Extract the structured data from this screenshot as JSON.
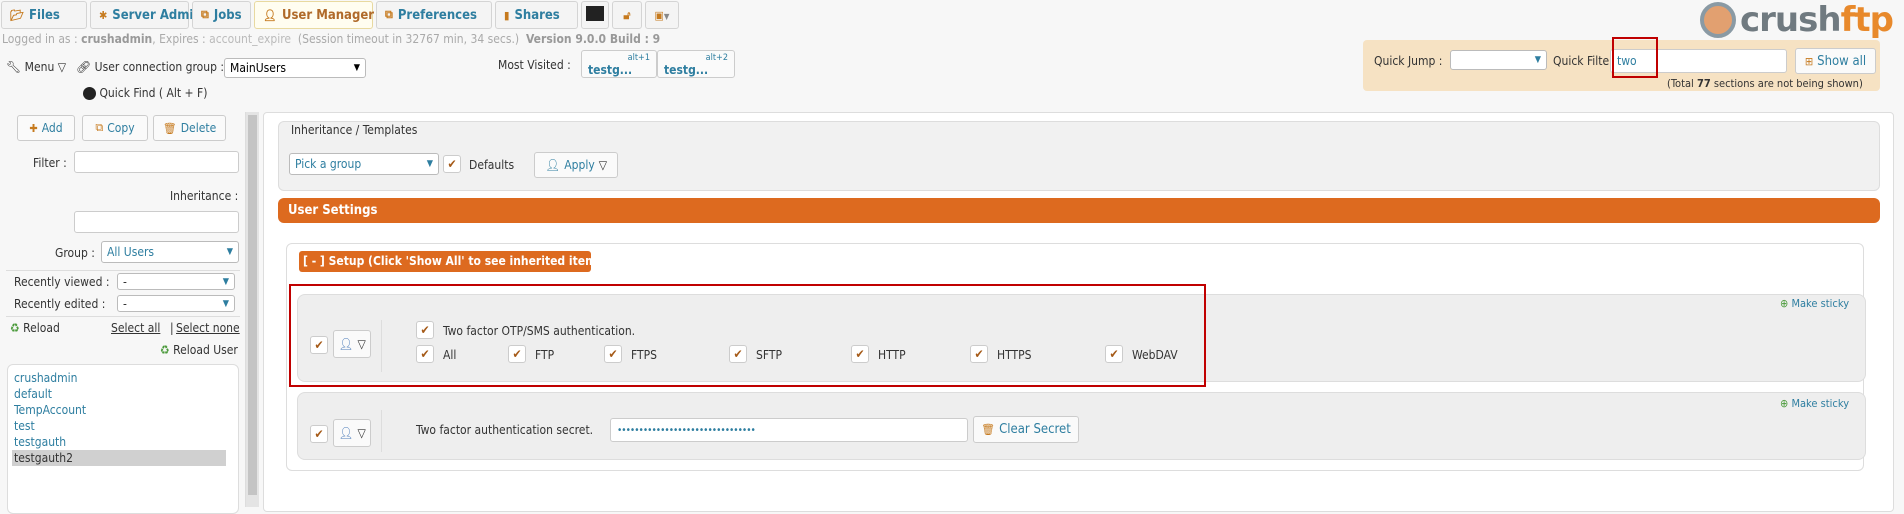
{
  "tabs": [
    {
      "label": "Files",
      "icon": "folder-icon"
    },
    {
      "label": "Server Admin",
      "icon": "gear-icon"
    },
    {
      "label": "Jobs",
      "icon": "jobs-icon"
    },
    {
      "label": "User Manager",
      "icon": "user-icon",
      "active": true
    },
    {
      "label": "Preferences",
      "icon": "preferences-icon"
    },
    {
      "label": "Shares",
      "icon": "shares-icon"
    }
  ],
  "extra_tabs": [
    "terminal-icon",
    "lock-icon",
    "image-menu-icon"
  ],
  "status": {
    "logged_in_label": "Logged in as :",
    "user": "crushadmin",
    "expires_label": ", Expires :",
    "expires": "account_expire",
    "session": "(Session timeout in 32767 min, 34 secs.)",
    "version": "Version 9.0.0 Build : 9"
  },
  "toolbar": {
    "menu": "Menu",
    "group_label": "User connection group :",
    "group_value": "MainUsers",
    "quick_find": "Quick Find ( Alt + F)",
    "most_visited": "Most Visited :",
    "visited": [
      {
        "label": "testg...",
        "shortcut": "alt+1"
      },
      {
        "label": "testg...",
        "shortcut": "alt+2"
      }
    ]
  },
  "quick": {
    "jump_label": "Quick Jump :",
    "jump_value": "",
    "filter_label": "Quick Filter",
    "filter_value": "two",
    "show_all": "Show all",
    "hidden_prefix": "(Total ",
    "hidden_count": "77",
    "hidden_suffix": " sections are not being shown)"
  },
  "logo": {
    "text_a": "crush",
    "text_b": "ftp",
    "accent": "#e8892b"
  },
  "sidebar": {
    "add": "Add",
    "copy": "Copy",
    "delete": "Delete",
    "filter_label": "Filter :",
    "filter_value": "",
    "inheritance_label": "Inheritance :",
    "inheritance_value": "",
    "group_label": "Group :",
    "group_value": "All Users",
    "recent_viewed_label": "Recently viewed :",
    "recent_viewed_value": "-",
    "recent_edited_label": "Recently edited :",
    "recent_edited_value": "-",
    "reload": "Reload",
    "select_all": "Select all",
    "separator": "|",
    "select_none": "Select none",
    "reload_user": "Reload User",
    "users": [
      "crushadmin",
      "default",
      "TempAccount",
      "test",
      "testgauth",
      "testgauth2"
    ],
    "selected_user": "testgauth2"
  },
  "main": {
    "inheritance_title": "Inheritance / Templates",
    "pick_group": "Pick a group",
    "defaults_label": "Defaults",
    "apply": "Apply",
    "user_settings": "User Settings",
    "setup_label": "[ - ] Setup (Click 'Show All' to see inherited items.)",
    "row1": {
      "make_sticky": "Make sticky",
      "title": "Two factor OTP/SMS authentication.",
      "protocols": [
        "All",
        "FTP",
        "FTPS",
        "SFTP",
        "HTTP",
        "HTTPS",
        "WebDAV"
      ]
    },
    "row2": {
      "make_sticky": "Make sticky",
      "label": "Two factor authentication secret.",
      "secret": "••••••••••••••••••••••••••••••••",
      "clear": "Clear Secret"
    }
  },
  "colors": {
    "accent_orange": "#dd6a1f",
    "link_blue": "#2e7ea0",
    "highlight_red": "#c00000",
    "quick_panel": "#f6e2c3"
  }
}
